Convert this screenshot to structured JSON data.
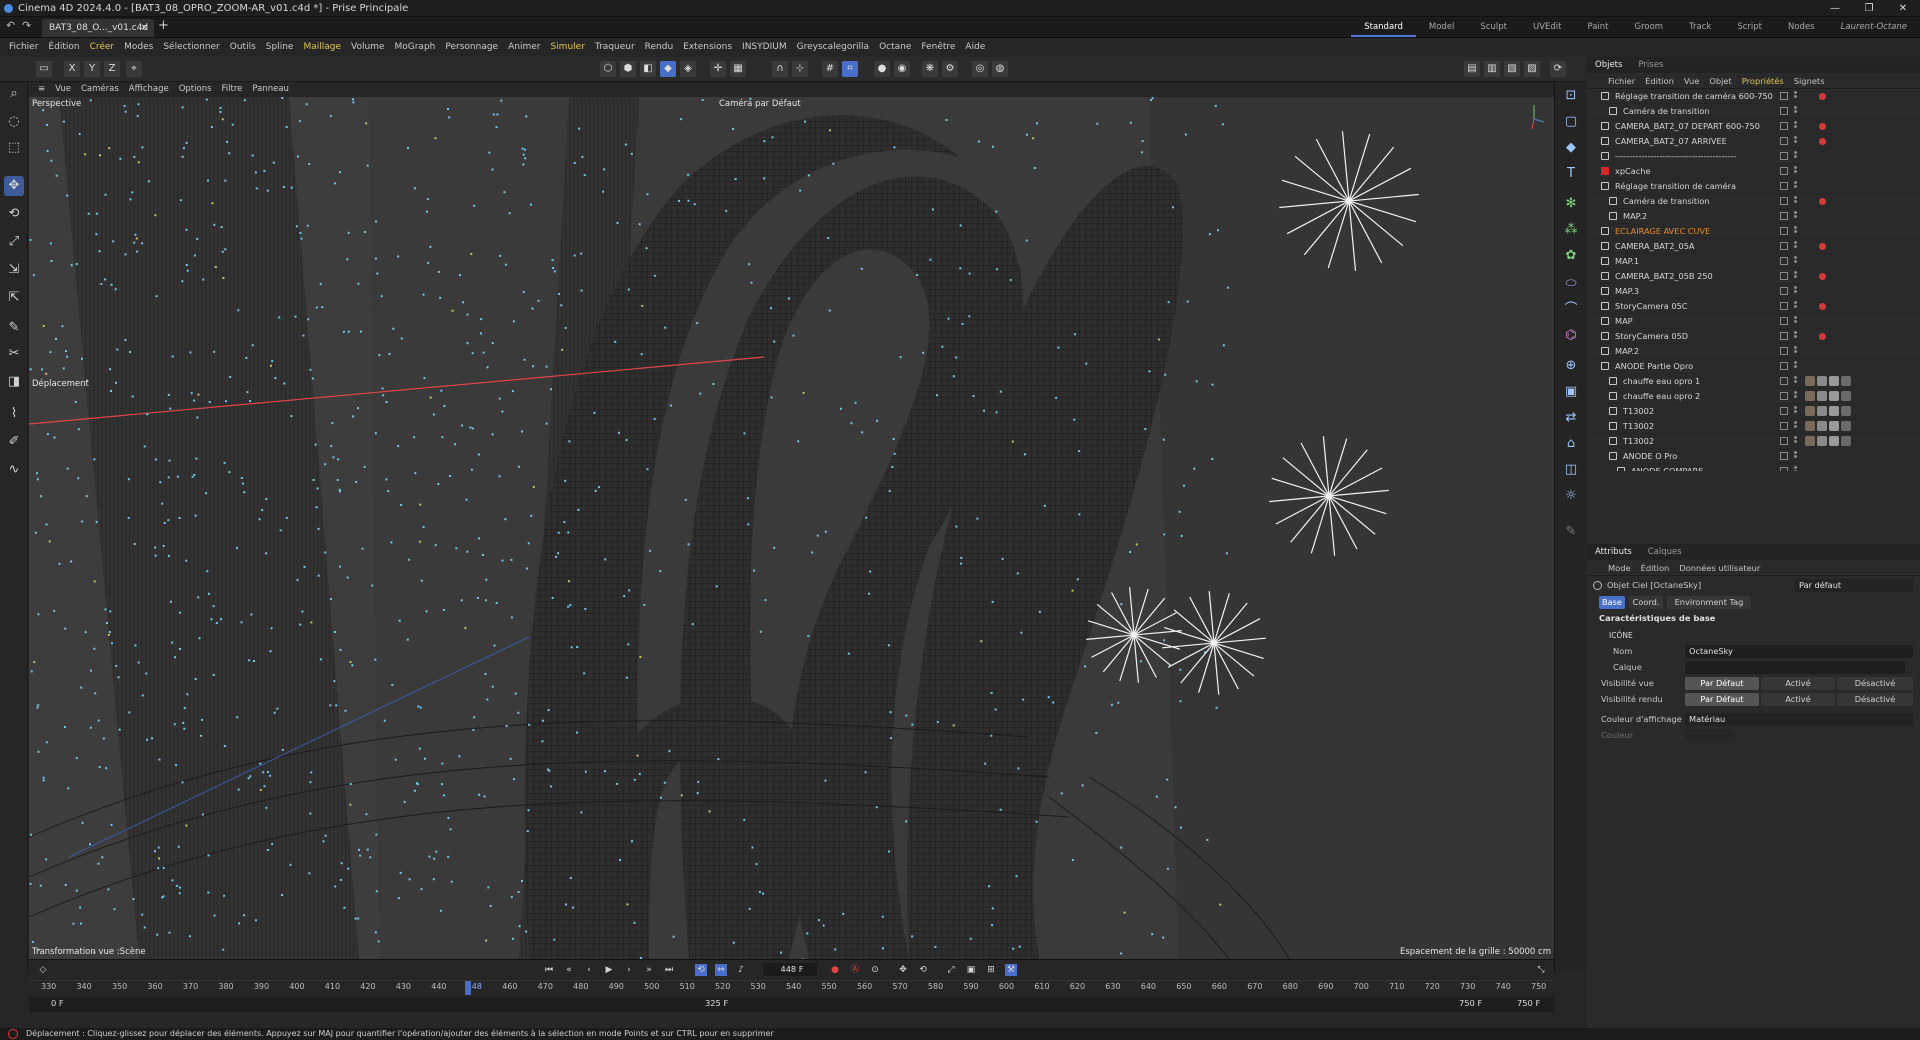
{
  "window": {
    "title": "Cinema 4D 2024.4.0 - [BAT3_08_OPRO_ZOOM-AR_v01.c4d *] - Prise Principale",
    "controls": [
      "—",
      "❐",
      "✕"
    ]
  },
  "tab": {
    "doc": "BAT3_08_O..._v01.c4d *"
  },
  "layouts": [
    "Standard",
    "Model",
    "Sculpt",
    "UVEdit",
    "Paint",
    "Groom",
    "Track",
    "Script",
    "Nodes",
    "Laurent-Octane"
  ],
  "menu": [
    "Fichier",
    "Édition",
    "Créer",
    "Modes",
    "Sélectionner",
    "Outils",
    "Spline",
    "Maillage",
    "Volume",
    "MoGraph",
    "Personnage",
    "Animer",
    "Simuler",
    "Traqueur",
    "Rendu",
    "Extensions",
    "INSYDIUM",
    "Greyscalegorilla",
    "Octane",
    "Fenêtre",
    "Aide"
  ],
  "toolbar": {
    "axes": [
      "X",
      "Y",
      "Z"
    ]
  },
  "viewport_menu": [
    "Vue",
    "Caméras",
    "Affichage",
    "Options",
    "Filtre",
    "Panneau"
  ],
  "viewport": {
    "label": "Perspective",
    "camera": "Caméra par Défaut",
    "tool": "Déplacement",
    "transform": "Transformation vue :Scène",
    "grid": "Espacement de la grille : 50000 cm"
  },
  "objects_panel": {
    "tabs": [
      "Objets",
      "Prises"
    ],
    "menu": [
      "Fichier",
      "Édition",
      "Vue",
      "Objet",
      "Propriétés",
      "Signets"
    ],
    "rows": [
      {
        "name": "Réglage transition de caméra 600-750",
        "indent": 0
      },
      {
        "name": "Caméra de transition",
        "indent": 1
      },
      {
        "name": "CAMERA_BAT2_07 DEPART 600-750",
        "indent": 0
      },
      {
        "name": "CAMERA_BAT2_07 ARRIVEE",
        "indent": 0
      },
      {
        "name": "-----------------------------------------",
        "indent": 0
      },
      {
        "name": "xpCache",
        "indent": 0
      },
      {
        "name": "Réglage transition de caméra",
        "indent": 0
      },
      {
        "name": "Caméra de transition",
        "indent": 1
      },
      {
        "name": "MAP.2",
        "indent": 1
      },
      {
        "name": "ECLAIRAGE AVEC CUVE",
        "indent": 0,
        "orange": true
      },
      {
        "name": "CAMERA_BAT2_05A",
        "indent": 0
      },
      {
        "name": "MAP.1",
        "indent": 0
      },
      {
        "name": "CAMERA_BAT2_05B 250",
        "indent": 0
      },
      {
        "name": "MAP.3",
        "indent": 0
      },
      {
        "name": "StoryCamera 05C",
        "indent": 0
      },
      {
        "name": "MAP",
        "indent": 0
      },
      {
        "name": "StoryCamera 05D",
        "indent": 0
      },
      {
        "name": "MAP.2",
        "indent": 0
      },
      {
        "name": "ANODE Partie Opro",
        "indent": 0
      },
      {
        "name": "chauffe eau opro 1",
        "indent": 1
      },
      {
        "name": "chauffe eau opro 2",
        "indent": 1
      },
      {
        "name": "T13002",
        "indent": 1
      },
      {
        "name": "T13002",
        "indent": 1
      },
      {
        "name": "T13002",
        "indent": 1
      },
      {
        "name": "ANODE O Pro",
        "indent": 1
      },
      {
        "name": "ANODE COMPARE",
        "indent": 2
      }
    ]
  },
  "attributes": {
    "tabs": [
      "Attributs",
      "Calques"
    ],
    "menu": [
      "Mode",
      "Édition",
      "Données utilisateur"
    ],
    "object": "Objet Ciel [OctaneSky]",
    "preset": "Par défaut",
    "subtabs": [
      "Base",
      "Coord.",
      "Environment Tag"
    ],
    "section": "Caractéristiques de base",
    "group": "ICÔNE",
    "name_label": "Nom",
    "name_value": "OctaneSky",
    "layer_label": "Calque",
    "vis_editor": "Visibilité vue",
    "vis_render": "Visibilité rendu",
    "vis_options": [
      "Par Défaut",
      "Activé",
      "Désactivé"
    ],
    "display_color_label": "Couleur d'affichage",
    "display_color_value": "Matériau",
    "color_label": "Couleur"
  },
  "timeline": {
    "current_frame": "448 F",
    "ticks": [
      "330",
      "340",
      "350",
      "360",
      "370",
      "380",
      "390",
      "400",
      "410",
      "420",
      "430",
      "440",
      "448",
      "460",
      "470",
      "480",
      "490",
      "500",
      "510",
      "520",
      "530",
      "540",
      "550",
      "560",
      "570",
      "580",
      "590",
      "600",
      "610",
      "620",
      "630",
      "640",
      "650",
      "660",
      "670",
      "680",
      "690",
      "700",
      "710",
      "720",
      "730",
      "740",
      "750"
    ],
    "start": "0 F",
    "middle": "325 F",
    "end_a": "750 F",
    "end_b": "750 F"
  },
  "status": "Déplacement : Cliquez-glissez pour déplacer des éléments. Appuyez sur MAJ pour quantifier l'opération/ajouter des éléments à la sélection en mode Points et sur CTRL pour en supprimer",
  "colors": {
    "accent": "#4a6fc8",
    "highlight": "#e0c452",
    "orange": "#e08a2a",
    "viewport_bg": "#3b3b3b"
  }
}
